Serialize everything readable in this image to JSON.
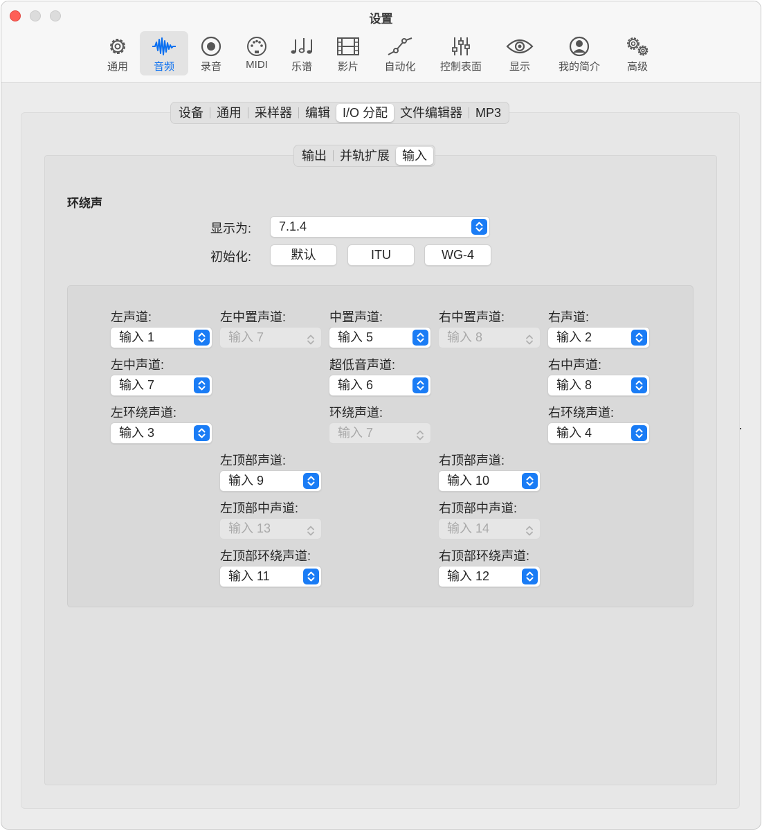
{
  "window": {
    "title": "设置"
  },
  "toolbar": {
    "items": [
      {
        "label": "通用",
        "icon": "gear-icon"
      },
      {
        "label": "音频",
        "icon": "waveform-icon",
        "active": true
      },
      {
        "label": "录音",
        "icon": "record-icon"
      },
      {
        "label": "MIDI",
        "icon": "midi-connector-icon"
      },
      {
        "label": "乐谱",
        "icon": "music-notes-icon"
      },
      {
        "label": "影片",
        "icon": "film-icon"
      },
      {
        "label": "自动化",
        "icon": "automation-curve-icon"
      },
      {
        "label": "控制表面",
        "icon": "sliders-icon"
      },
      {
        "label": "显示",
        "icon": "eye-icon"
      },
      {
        "label": "我的简介",
        "icon": "person-icon"
      },
      {
        "label": "高级",
        "icon": "gears-icon"
      }
    ]
  },
  "audio_tabs": [
    "设备",
    "通用",
    "采样器",
    "编辑",
    "I/O 分配",
    "文件编辑器",
    "MP3"
  ],
  "io_tabs": [
    "输出",
    "并轨扩展",
    "输入"
  ],
  "surround": {
    "title": "环绕声",
    "show_as_label": "显示为:",
    "show_as_value": "7.1.4",
    "init_label": "初始化:",
    "init_buttons": [
      "默认",
      "ITU",
      "WG-4"
    ]
  },
  "channels": {
    "left": {
      "label": "左声道:",
      "value": "输入 1",
      "enabled": true
    },
    "left_center": {
      "label": "左中置声道:",
      "value": "输入 7",
      "enabled": false
    },
    "center": {
      "label": "中置声道:",
      "value": "输入 5",
      "enabled": true
    },
    "right_center": {
      "label": "右中置声道:",
      "value": "输入 8",
      "enabled": false
    },
    "right": {
      "label": "右声道:",
      "value": "输入 2",
      "enabled": true
    },
    "left_mid": {
      "label": "左中声道:",
      "value": "输入 7",
      "enabled": true
    },
    "lfe": {
      "label": "超低音声道:",
      "value": "输入 6",
      "enabled": true
    },
    "right_mid": {
      "label": "右中声道:",
      "value": "输入 8",
      "enabled": true
    },
    "left_surround": {
      "label": "左环绕声道:",
      "value": "输入 3",
      "enabled": true
    },
    "surround": {
      "label": "环绕声道:",
      "value": "输入 7",
      "enabled": false
    },
    "right_surround": {
      "label": "右环绕声道:",
      "value": "输入 4",
      "enabled": true
    },
    "left_top": {
      "label": "左顶部声道:",
      "value": "输入 9",
      "enabled": true
    },
    "right_top": {
      "label": "右顶部声道:",
      "value": "输入 10",
      "enabled": true
    },
    "left_top_mid": {
      "label": "左顶部中声道:",
      "value": "输入 13",
      "enabled": false
    },
    "right_top_mid": {
      "label": "右顶部中声道:",
      "value": "输入 14",
      "enabled": false
    },
    "left_top_surround": {
      "label": "左顶部环绕声道:",
      "value": "输入 11",
      "enabled": true
    },
    "right_top_surround": {
      "label": "右顶部环绕声道:",
      "value": "输入 12",
      "enabled": true
    }
  },
  "colors": {
    "accent": "#1a7cf5",
    "active_text": "#0a6ff0"
  }
}
